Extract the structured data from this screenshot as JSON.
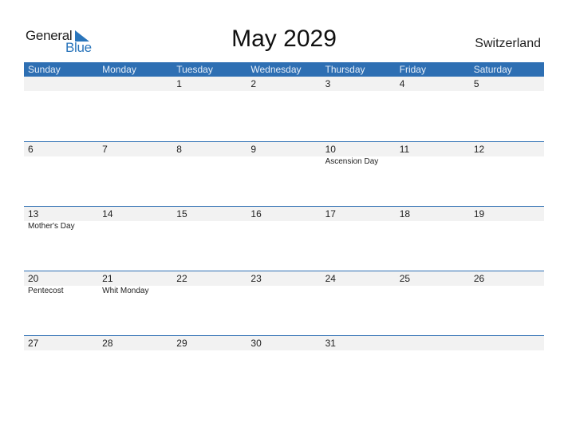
{
  "logo": {
    "part1": "General",
    "part2": "Blue"
  },
  "title": "May 2029",
  "country": "Switzerland",
  "colors": {
    "accent": "#2e6fb3",
    "band": "#f2f2f2",
    "logo_blue": "#2a75bb"
  },
  "weekdays": [
    "Sunday",
    "Monday",
    "Tuesday",
    "Wednesday",
    "Thursday",
    "Friday",
    "Saturday"
  ],
  "weeks": [
    [
      {
        "day": ""
      },
      {
        "day": ""
      },
      {
        "day": "1"
      },
      {
        "day": "2"
      },
      {
        "day": "3"
      },
      {
        "day": "4"
      },
      {
        "day": "5"
      }
    ],
    [
      {
        "day": "6"
      },
      {
        "day": "7"
      },
      {
        "day": "8"
      },
      {
        "day": "9"
      },
      {
        "day": "10",
        "holiday": "Ascension Day"
      },
      {
        "day": "11"
      },
      {
        "day": "12"
      }
    ],
    [
      {
        "day": "13",
        "holiday": "Mother's Day"
      },
      {
        "day": "14"
      },
      {
        "day": "15"
      },
      {
        "day": "16"
      },
      {
        "day": "17"
      },
      {
        "day": "18"
      },
      {
        "day": "19"
      }
    ],
    [
      {
        "day": "20",
        "holiday": "Pentecost"
      },
      {
        "day": "21",
        "holiday": "Whit Monday"
      },
      {
        "day": "22"
      },
      {
        "day": "23"
      },
      {
        "day": "24"
      },
      {
        "day": "25"
      },
      {
        "day": "26"
      }
    ],
    [
      {
        "day": "27"
      },
      {
        "day": "28"
      },
      {
        "day": "29"
      },
      {
        "day": "30"
      },
      {
        "day": "31"
      },
      {
        "day": ""
      },
      {
        "day": ""
      }
    ]
  ]
}
